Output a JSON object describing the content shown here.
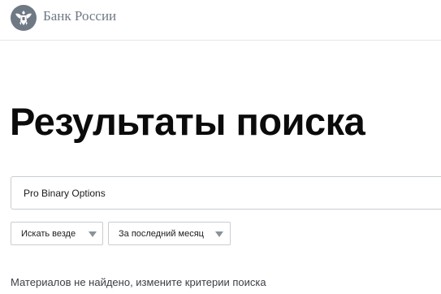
{
  "header": {
    "brand_name": "Банк России",
    "logo_icon": "double-headed-eagle-emblem",
    "logo_color": "#6f7985"
  },
  "main": {
    "title": "Результаты поиска",
    "search": {
      "value": "Pro Binary Options",
      "placeholder": ""
    },
    "filters": {
      "scope": {
        "selected": "Искать везде",
        "icon": "chevron-down-icon"
      },
      "period": {
        "selected": "За последний месяц",
        "icon": "chevron-down-icon"
      }
    },
    "message": "Материалов не найдено, измените критерии поиска"
  },
  "colors": {
    "border": "#c9cdd2",
    "divider": "#e6e6e6",
    "chevron": "#8a929b",
    "muted_text": "#3a3f45"
  }
}
